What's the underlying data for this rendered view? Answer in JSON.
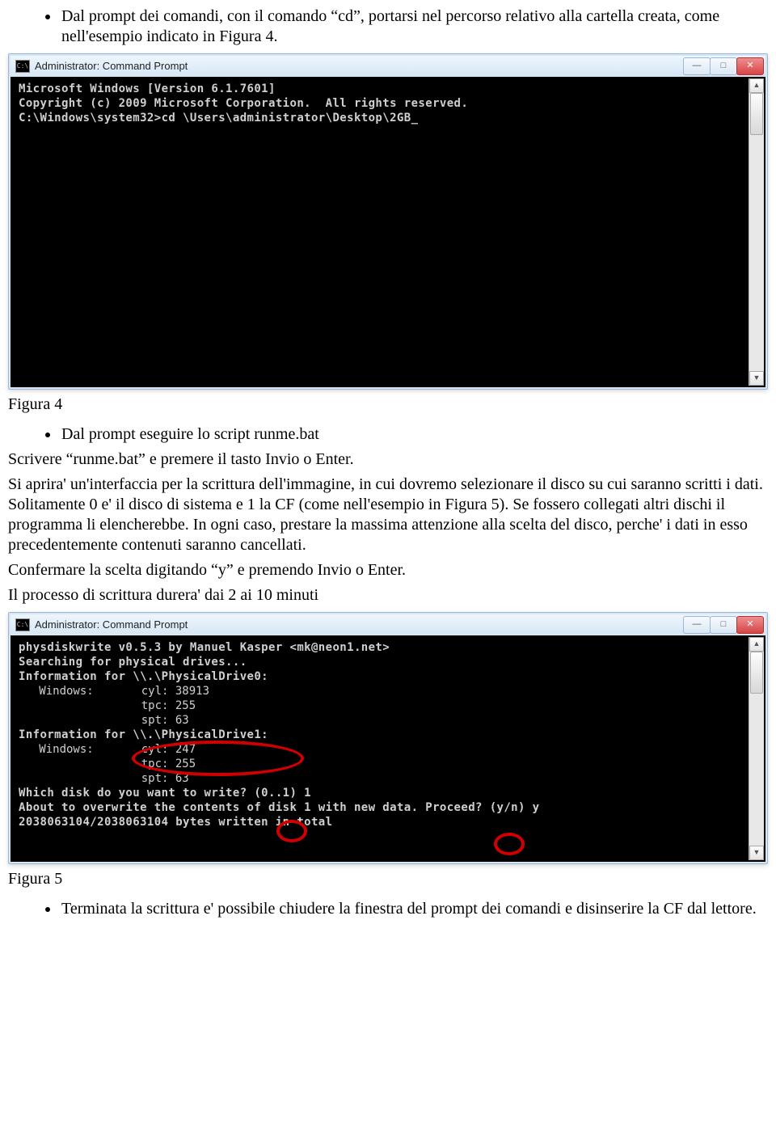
{
  "bullet1": {
    "text": "Dal prompt dei comandi, con il comando “cd”, portarsi nel percorso relativo alla cartella creata, come nell'esempio indicato in Figura 4."
  },
  "fig4_caption": "Figura 4",
  "fig4_window_title": "Administrator: Command Prompt",
  "fig4_console": {
    "line1": "Microsoft Windows [Version 6.1.7601]",
    "line2": "Copyright (c) 2009 Microsoft Corporation.  All rights reserved.",
    "line3": "",
    "line4": "C:\\Windows\\system32>cd \\Users\\administrator\\Desktop\\2GB_"
  },
  "bullet2": {
    "text": "Dal prompt eseguire lo script runme.bat"
  },
  "body1": "Scrivere “runme.bat” e premere il tasto Invio o Enter.",
  "body2": "Si aprira' un'interfaccia per la scrittura dell'immagine, in cui dovremo selezionare il disco su cui saranno scritti i dati. Solitamente 0 e' il disco di sistema e 1 la CF (come nell'esempio in Figura 5). Se fossero collegati altri dischi il programma li elencherebbe. In ogni caso, prestare la massima attenzione alla scelta del disco, perche' i dati in esso precedentemente contenuti saranno cancellati.",
  "body3": "Confermare la scelta digitando “y” e premendo Invio o Enter.",
  "body4": "Il processo di scrittura durera' dai 2 ai 10 minuti",
  "fig5_caption": "Figura 5",
  "fig5_window_title": "Administrator: Command Prompt",
  "fig5_console": {
    "l1": "physdiskwrite v0.5.3 by Manuel Kasper <mk@neon1.net>",
    "l2": "",
    "l3": "Searching for physical drives...",
    "l4": "",
    "l5": "Information for \\\\.\\PhysicalDrive0:",
    "l6": "   Windows:       cyl: 38913",
    "l7": "                  tpc: 255",
    "l8": "                  spt: 63",
    "l9": "Information for \\\\.\\PhysicalDrive1:",
    "l10": "   Windows:       cyl: 247",
    "l11": "                  tpc: 255",
    "l12": "                  spt: 63",
    "l13": "",
    "l14": "Which disk do you want to write? (0..1) 1",
    "l15": "About to overwrite the contents of disk 1 with new data. Proceed? (y/n) y",
    "l16": "2038063104/2038063104 bytes written in total"
  },
  "bullet3": {
    "text": "Terminata la scrittura e' possibile chiudere la finestra del prompt dei comandi e disinserire la CF dal lettore."
  },
  "win_buttons": {
    "min": "—",
    "max": "□",
    "close": "✕"
  },
  "cmd_icon_label": "C:\\"
}
